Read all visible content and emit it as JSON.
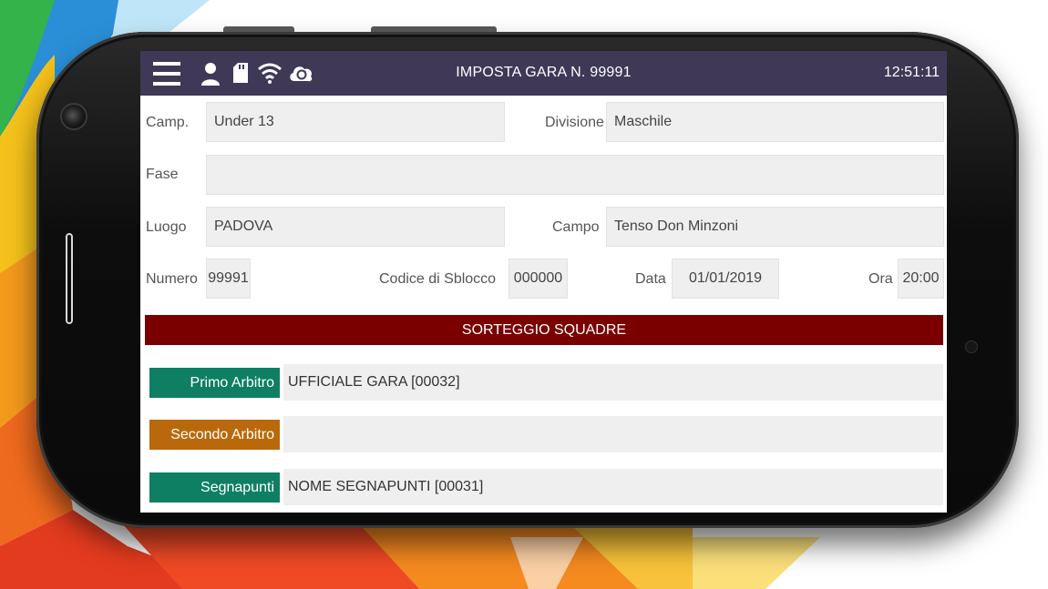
{
  "header": {
    "title": "IMPOSTA GARA N. 99991",
    "time": "12:51:11",
    "icons": [
      "menu-icon",
      "user-icon",
      "sd-card-icon",
      "wifi-icon",
      "cloud-sync-icon"
    ]
  },
  "form": {
    "camp_label": "Camp.",
    "camp_value": "Under 13",
    "divisione_label": "Divisione",
    "divisione_value": "Maschile",
    "fase_label": "Fase",
    "fase_value": "",
    "luogo_label": "Luogo",
    "luogo_value": "PADOVA",
    "campo_label": "Campo",
    "campo_value": "Tenso Don Minzoni",
    "numero_label": "Numero",
    "numero_value": "99991",
    "codice_label": "Codice di Sblocco",
    "codice_value": "000000",
    "data_label": "Data",
    "data_value": "01/01/2019",
    "ora_label": "Ora",
    "ora_value": "20:00"
  },
  "banner": {
    "label": "SORTEGGIO SQUADRE"
  },
  "officials": [
    {
      "role": "Primo Arbitro",
      "value": "UFFICIALE GARA [00032]",
      "color": "#0e7f62"
    },
    {
      "role": "Secondo Arbitro",
      "value": "",
      "color": "#b9690b"
    },
    {
      "role": "Segnapunti",
      "value": "NOME SEGNAPUNTI [00031]",
      "color": "#0e7f62"
    }
  ],
  "colors": {
    "statusbar": "#3f3957",
    "banner": "#7a0000"
  }
}
